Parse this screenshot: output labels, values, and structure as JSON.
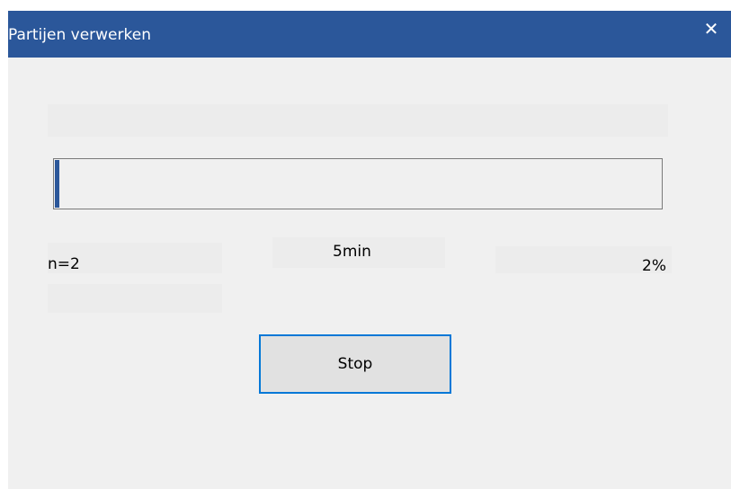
{
  "window": {
    "title": "Partijen verwerken",
    "close_glyph": "✕",
    "close_icon": "close-icon"
  },
  "progress": {
    "value_percent": 2
  },
  "labels": {
    "count": "n=2",
    "time": "5min",
    "percent": "2%"
  },
  "buttons": {
    "stop_label": "Stop"
  },
  "colors": {
    "titlebar": "#2b579a",
    "progress_fill": "#2b579a",
    "button_focus_border": "#0078d7"
  }
}
